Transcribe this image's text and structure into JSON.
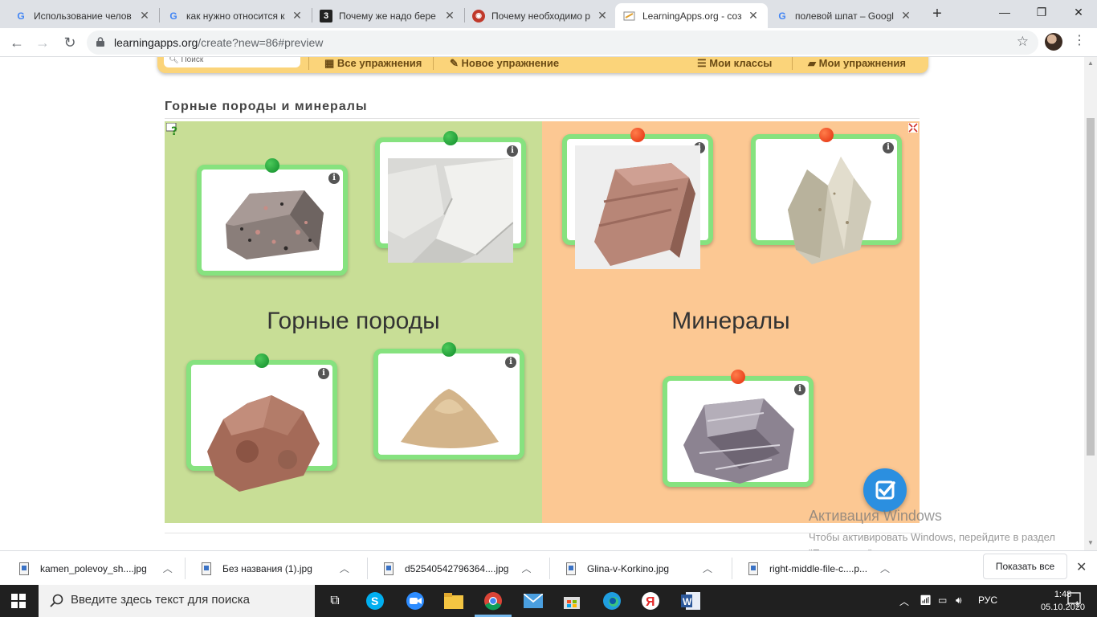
{
  "browser": {
    "tabs": [
      {
        "title": "Использование челов",
        "favicon": "google-icon"
      },
      {
        "title": "как нужно относится к",
        "favicon": "google-icon"
      },
      {
        "title": "Почему же надо бере",
        "favicon": "znanija-icon"
      },
      {
        "title": "Почему необходимо р",
        "favicon": "site-icon"
      },
      {
        "title": "LearningApps.org - соз",
        "favicon": "learningapps-icon",
        "active": true
      },
      {
        "title": "полевой шпат – Googl",
        "favicon": "google-icon"
      }
    ],
    "url_host": "learningapps.org",
    "url_path": "/create?new=86#preview"
  },
  "site_nav": {
    "search_placeholder": "Поиск",
    "all_exercises": "Все упражнения",
    "new_exercise": "Новое упражнение",
    "my_classes": "Мои классы",
    "my_exercises": "Мои упражнения"
  },
  "app": {
    "title": "Горные породы и минералы",
    "zones": [
      {
        "label": "Горные породы",
        "color": "#c8de96"
      },
      {
        "label": "Минералы",
        "color": "#fcc893"
      }
    ],
    "cards": [
      {
        "name": "granite-card",
        "zone": "Горные породы",
        "pin": "green",
        "image": "granite"
      },
      {
        "name": "chalk-card",
        "zone": "Горные породы",
        "pin": "green",
        "image": "chalk"
      },
      {
        "name": "clay-card",
        "zone": "Горные породы",
        "pin": "green",
        "image": "clay"
      },
      {
        "name": "sand-card",
        "zone": "Горные породы",
        "pin": "green",
        "image": "sand"
      },
      {
        "name": "feldspar-card",
        "zone": "Минералы",
        "pin": "red",
        "image": "feldspar"
      },
      {
        "name": "quartz-card",
        "zone": "Минералы",
        "pin": "red",
        "image": "quartz"
      },
      {
        "name": "mica-card",
        "zone": "Минералы",
        "pin": "red",
        "image": "mica"
      }
    ],
    "pin_colors": {
      "green": "#0f8c2a",
      "red": "#e22c0c"
    },
    "card_border_color": "#86e27f"
  },
  "watermark": {
    "heading": "Активация Windows",
    "text": "Чтобы активировать Windows, перейдите в раздел \"Параметры\"."
  },
  "downloads": {
    "items": [
      "kamen_polevoy_sh....jpg",
      "Без названия (1).jpg",
      "d52540542796364....jpg",
      "Glina-v-Korkino.jpg",
      "right-middle-file-c....p..."
    ],
    "show_all": "Показать все"
  },
  "taskbar": {
    "search_placeholder": "Введите здесь текст для поиска",
    "language": "РУС",
    "time": "1:48",
    "date": "05.10.2020",
    "notification_count": "1"
  }
}
